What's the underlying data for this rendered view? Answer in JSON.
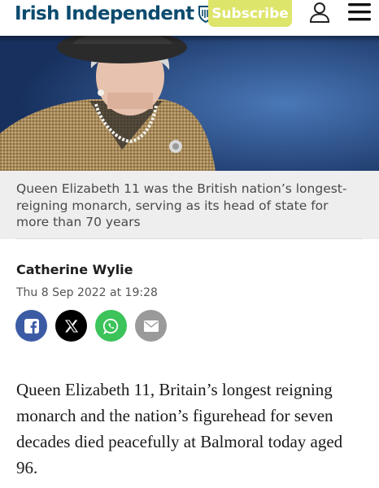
{
  "header": {
    "logo_text": "Irish Independent",
    "subscribe_label": "Subscribe",
    "user_icon": "user-icon",
    "menu_icon": "hamburger-menu-icon"
  },
  "article": {
    "caption": "Queen Elizabeth 11 was the British nation’s longest-reigning monarch, serving as its head of state for more than 70 years",
    "author": "Catherine Wylie",
    "date": "Thu 8 Sep 2022 at 19:28",
    "body": "Queen Elizabeth 11, Britain’s longest reigning monarch and the nation’s figurehead for seven decades died peacefully at Balmoral today aged 96."
  },
  "share": [
    {
      "name": "facebook-share-button",
      "icon": "facebook-icon",
      "color": "#3b5ba5"
    },
    {
      "name": "x-share-button",
      "icon": "x-icon",
      "color": "#000000"
    },
    {
      "name": "whatsapp-share-button",
      "icon": "whatsapp-icon",
      "color": "#3cc35a"
    },
    {
      "name": "email-share-button",
      "icon": "envelope-icon",
      "color": "#9a9a9a"
    }
  ],
  "colors": {
    "brand": "#0b4b6e",
    "subscribe": "#dde56b",
    "caption_bg": "#eeeeee"
  }
}
